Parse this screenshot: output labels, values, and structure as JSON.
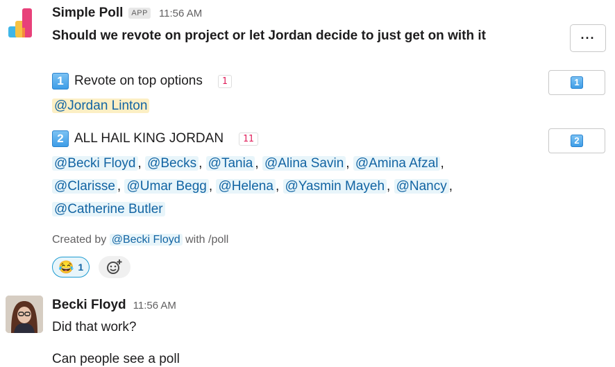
{
  "poll_message": {
    "sender": "Simple Poll",
    "app_badge": "APP",
    "time": "11:56 AM",
    "question": "Should we revote on project or let Jordan decide to just get on with it",
    "more_label": "···",
    "options": [
      {
        "number": "1",
        "label": "Revote on top options",
        "count": "1",
        "voters": [
          "@Jordan Linton"
        ]
      },
      {
        "number": "2",
        "label": "ALL HAIL KING JORDAN",
        "count": "11",
        "voters_line1": [
          "@Becki Floyd",
          "@Becks",
          "@Tania",
          "@Alina Savin",
          "@Amina Afzal"
        ],
        "voters_line2": [
          "@Clarisse",
          "@Umar Begg",
          "@Helena",
          "@Yasmin Mayeh",
          "@Nancy"
        ],
        "voters_line3": [
          "@Catherine Butler"
        ]
      }
    ],
    "created_by_prefix": "Created by",
    "created_by_user": "@Becki Floyd",
    "created_by_suffix": "with /poll",
    "reaction": {
      "emoji": "😂",
      "count": "1"
    }
  },
  "reply_message": {
    "sender": "Becki Floyd",
    "time": "11:56 AM",
    "lines": [
      "Did that work?",
      "Can people see a poll"
    ]
  },
  "colors": {
    "mention_text": "#1264a3",
    "mention_bg": "#e8f5fa",
    "self_mention_bg": "#fcefc4",
    "count_text": "#e01e5a",
    "reaction_border": "#1d9bd1"
  },
  "icons": {
    "app_logo": "simple-poll-logo-icon",
    "add_reaction": "add-reaction-icon"
  }
}
